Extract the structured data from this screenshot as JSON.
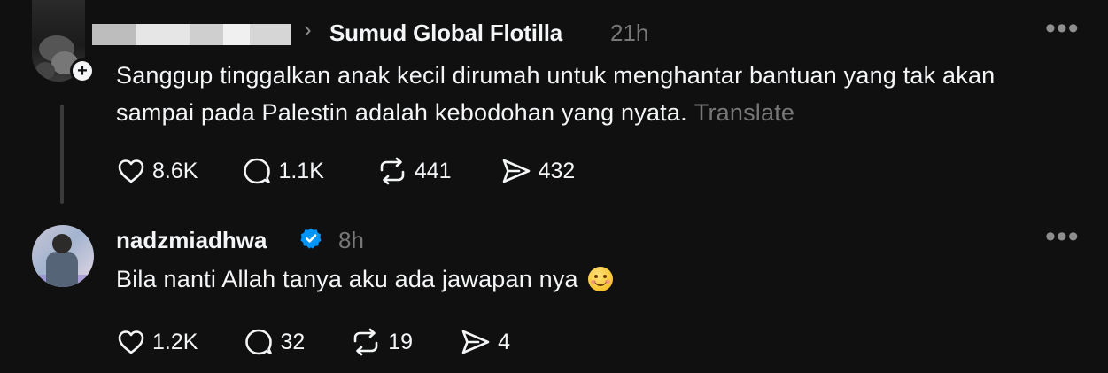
{
  "post1": {
    "target_chevron": "›",
    "target_name": "Sumud Global Flotilla",
    "time": "21h",
    "more_label": "•••",
    "follow_glyph": "+",
    "text": "Sanggup tinggalkan anak kecil dirumah untuk menghantar bantuan yang tak akan sampai pada Palestin adalah kebodohan yang nyata.",
    "translate_label": "Translate",
    "likes": "8.6K",
    "replies": "1.1K",
    "reposts": "441",
    "shares": "432"
  },
  "post2": {
    "username": "nadzmiadhwa",
    "time": "8h",
    "more_label": "•••",
    "text": "Bila nanti Allah tanya aku ada jawapan nya",
    "likes": "1.2K",
    "replies": "32",
    "reposts": "19",
    "shares": "4"
  },
  "icons": {
    "like": "heart-icon",
    "reply": "speech-bubble-icon",
    "repost": "repost-arrows-icon",
    "share": "send-icon",
    "verified": "verified-badge-icon",
    "follow": "plus-icon",
    "emoji": "smiling-face-emoji"
  },
  "colors": {
    "background": "#101010",
    "text": "#f3f5f7",
    "muted": "#777777",
    "verified": "#0095f6",
    "thread_line": "#3a3a3a"
  }
}
